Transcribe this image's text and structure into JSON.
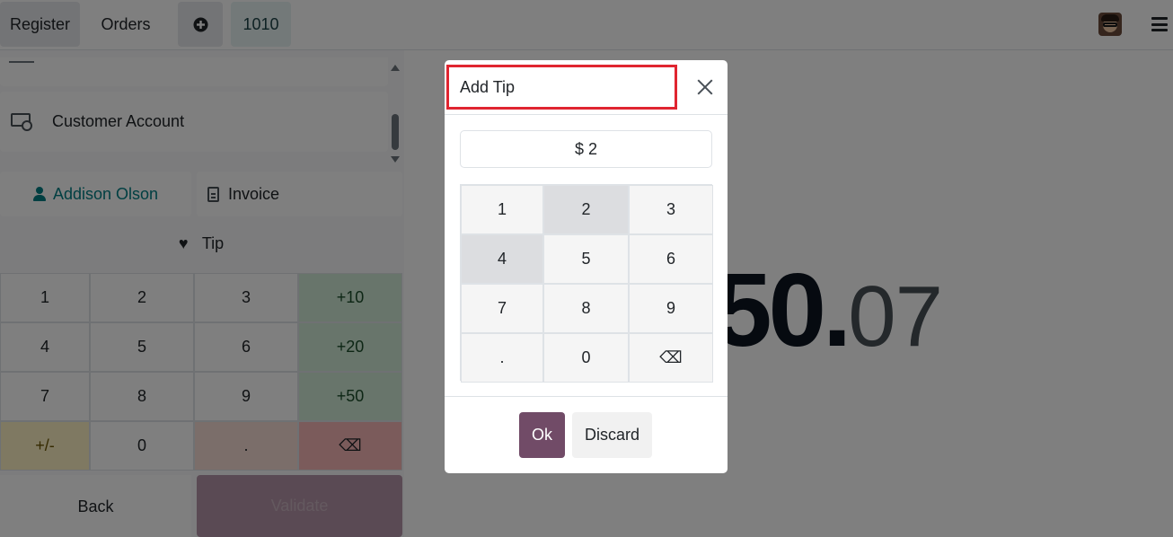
{
  "topbar": {
    "register_label": "Register",
    "orders_label": "Orders",
    "new_order_icon": "plus-circle-icon",
    "order_number": "1010",
    "avatar_icon": "user-avatar",
    "menu_icon": "hamburger-icon"
  },
  "payment": {
    "method_label": "Customer Account",
    "method_icon": "wallet-clock-icon",
    "customer_name": "Addison Olson",
    "invoice_label": "Invoice",
    "tip_label": "Tip",
    "numpad_keys": [
      "1",
      "2",
      "3",
      "+10",
      "4",
      "5",
      "6",
      "+20",
      "7",
      "8",
      "9",
      "+50",
      "+/-",
      "0",
      ".",
      "⌫"
    ],
    "back_label": "Back",
    "validate_label": "Validate",
    "amount_main": "50.",
    "amount_cents": "07"
  },
  "modal": {
    "title": "Add Tip",
    "input_value": "$ 2",
    "keys": [
      "1",
      "2",
      "3",
      "4",
      "5",
      "6",
      "7",
      "8",
      "9",
      ".",
      "0",
      "⌫"
    ],
    "ok_label": "Ok",
    "discard_label": "Discard"
  },
  "colors": {
    "accent": "#714b67",
    "customer": "#017e84",
    "highlight_border": "#e02530"
  }
}
